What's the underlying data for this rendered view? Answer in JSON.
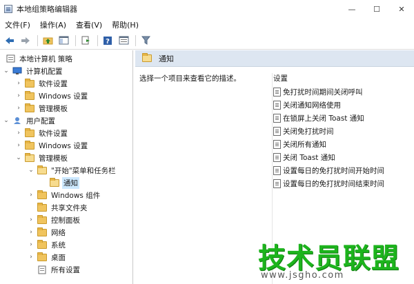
{
  "window": {
    "title": "本地组策略编辑器",
    "minimize": "—",
    "maximize": "☐",
    "close": "✕"
  },
  "menu": [
    {
      "label": "文件(F)"
    },
    {
      "label": "操作(A)"
    },
    {
      "label": "查看(V)"
    },
    {
      "label": "帮助(H)"
    }
  ],
  "toolbar": {
    "back_icon": "arrow-left-icon",
    "forward_icon": "arrow-right-icon",
    "filter_icon": "filter-icon"
  },
  "tree": {
    "root": "本地计算机 策略",
    "computer_config": "计算机配置",
    "computer_software": "软件设置",
    "computer_windows": "Windows 设置",
    "computer_admin": "管理模板",
    "user_config": "用户配置",
    "user_software": "软件设置",
    "user_windows": "Windows 设置",
    "user_admin": "管理模板",
    "start_taskbar": "\"开始\"菜单和任务栏",
    "notifications": "通知",
    "windows_components": "Windows 组件",
    "shared_folders": "共享文件夹",
    "control_panel": "控制面板",
    "network": "网络",
    "system": "系统",
    "desktop": "桌面",
    "all_settings": "所有设置"
  },
  "right_pane": {
    "header_title": "通知",
    "description": "选择一个项目来查看它的描述。",
    "settings_header": "设置",
    "settings": [
      {
        "label": "免打扰时间期间关闭呼叫"
      },
      {
        "label": "关闭通知网络使用"
      },
      {
        "label": "在锁屏上关闭 Toast 通知"
      },
      {
        "label": "关闭免打扰时间"
      },
      {
        "label": "关闭所有通知"
      },
      {
        "label": "关闭 Toast 通知"
      },
      {
        "label": "设置每日的免打扰时间开始时间"
      },
      {
        "label": "设置每日的免打扰时间结束时间"
      }
    ]
  },
  "watermark": {
    "brand": "技术员联盟",
    "url": "www.jsgho.com"
  },
  "colors": {
    "header_bg": "#dde6f1",
    "selected_bg": "#cce8ff",
    "folder": "#f0c45e",
    "watermark": "#1db41d"
  }
}
